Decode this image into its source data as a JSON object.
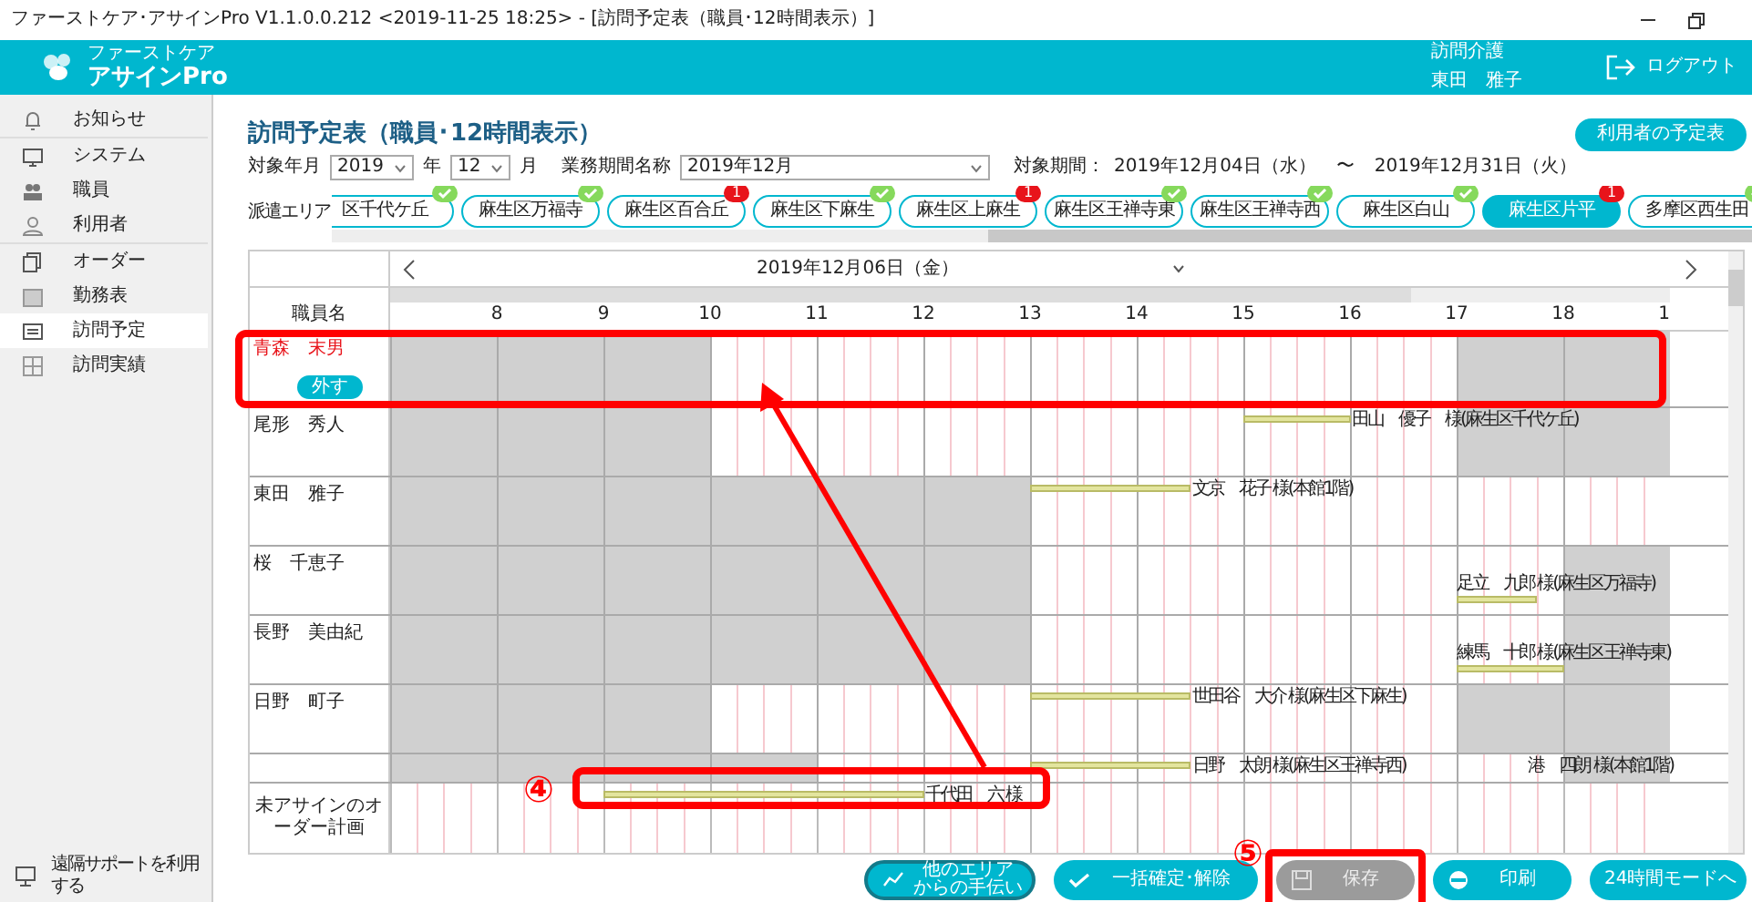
{
  "window": {
    "title": "ファーストケア･アサインPro V1.1.0.0.212 <2019-11-25 18:25> - [訪問予定表（職員･12時間表示）]"
  },
  "header": {
    "logo_small": "ファーストケア",
    "logo": "アサインPro",
    "service": "訪問介護",
    "user": "東田　雅子",
    "logout": "ログアウト"
  },
  "sidebar": {
    "items": [
      {
        "label": "お知らせ",
        "selected": false,
        "divider_after": true
      },
      {
        "label": "システム",
        "selected": false,
        "divider_after": false
      },
      {
        "label": "職員",
        "selected": false,
        "divider_after": false
      },
      {
        "label": "利用者",
        "selected": false,
        "divider_after": true
      },
      {
        "label": "オーダー",
        "selected": false,
        "divider_after": false
      },
      {
        "label": "勤務表",
        "selected": false,
        "divider_after": false
      },
      {
        "label": "訪問予定",
        "selected": true,
        "divider_after": false
      },
      {
        "label": "訪問実績",
        "selected": false,
        "divider_after": false
      }
    ],
    "footer": "遠隔サポートを利用する"
  },
  "page": {
    "title": "訪問予定表（職員･12時間表示）",
    "user_schedule_button": "利用者の予定表"
  },
  "filters": {
    "year_label": "対象年月",
    "year": "2019",
    "year_unit": "年",
    "month": "12",
    "month_unit": "月",
    "period_label": "業務期間名称",
    "period": "2019年12月",
    "range_label": "対象期間：",
    "range_start": "2019年12月04日（水）",
    "range_sep": "〜",
    "range_end": "2019年12月31日（火）"
  },
  "areas": {
    "label": "派遣エリア",
    "items": [
      {
        "name": "区千代ケ丘",
        "kind": "check",
        "selected": false
      },
      {
        "name": "麻生区万福寺",
        "kind": "check",
        "selected": false
      },
      {
        "name": "麻生区百合丘",
        "kind": "count",
        "count": "1",
        "selected": false
      },
      {
        "name": "麻生区下麻生",
        "kind": "check",
        "selected": false
      },
      {
        "name": "麻生区上麻生",
        "kind": "count",
        "count": "1",
        "selected": false
      },
      {
        "name": "麻生区王禅寺東",
        "kind": "check",
        "selected": false
      },
      {
        "name": "麻生区王禅寺西",
        "kind": "check",
        "selected": false
      },
      {
        "name": "麻生区白山",
        "kind": "check",
        "selected": false
      },
      {
        "name": "麻生区片平",
        "kind": "count",
        "count": "1",
        "selected": true
      },
      {
        "name": "多摩区西生田",
        "kind": "check",
        "selected": false
      }
    ]
  },
  "schedule": {
    "date": "2019年12月06日（金）",
    "name_header": "職員名",
    "hours": [
      "8",
      "9",
      "10",
      "11",
      "12",
      "13",
      "14",
      "15",
      "16",
      "17",
      "18",
      "1"
    ],
    "staff": [
      {
        "name": "青森　末男",
        "selected": true,
        "action": "外す",
        "annotated": true
      },
      {
        "name": "尾形　秀人",
        "selected": false,
        "visits": [
          {
            "label": "田山　優子　様(麻生区千代ケ丘)",
            "kind": "after"
          }
        ]
      },
      {
        "name": "東田　雅子",
        "selected": false,
        "visits": [
          {
            "label": "文京　花子 様(本館1階)",
            "kind": "after"
          }
        ]
      },
      {
        "name": "桜　千恵子",
        "selected": false,
        "visits": [
          {
            "label": "足立　九郎 様(麻生区万福寺)",
            "kind": "above"
          }
        ]
      },
      {
        "name": "長野　美由紀",
        "selected": false,
        "visits": [
          {
            "label": "練馬　十郎 様(麻生区王禅寺東)",
            "kind": "above"
          }
        ]
      },
      {
        "name": "日野　町子",
        "selected": false,
        "visits": [
          {
            "label": "世田谷　大介 様(麻生区下麻生)",
            "kind": "after"
          }
        ]
      },
      {
        "selected": false,
        "visits": [
          {
            "label": "日野　太朗 様(麻生区王禅寺西)",
            "kind": "after"
          },
          {
            "label": "港　四朗 様(本館1階)",
            "kind": "above"
          }
        ]
      }
    ],
    "unassigned": {
      "label": "未アサインのオーダー計画",
      "visits": [
        {
          "label": "千代田　六 様",
          "kind": "after",
          "annotation": "④"
        }
      ]
    }
  },
  "actions": [
    {
      "lines": [
        "他のエリア",
        "からの手伝い"
      ],
      "disabled": false,
      "kind": "outline"
    },
    {
      "lines": [
        "一括確定･解除"
      ],
      "disabled": false,
      "kind": "fill"
    },
    {
      "lines": [
        "保存"
      ],
      "disabled": true,
      "kind": "fill",
      "annotation": "⑤"
    },
    {
      "lines": [
        "印刷"
      ],
      "disabled": false,
      "kind": "fill"
    },
    {
      "lines": [
        "24時間モードへ"
      ],
      "disabled": false,
      "kind": "fill"
    }
  ]
}
